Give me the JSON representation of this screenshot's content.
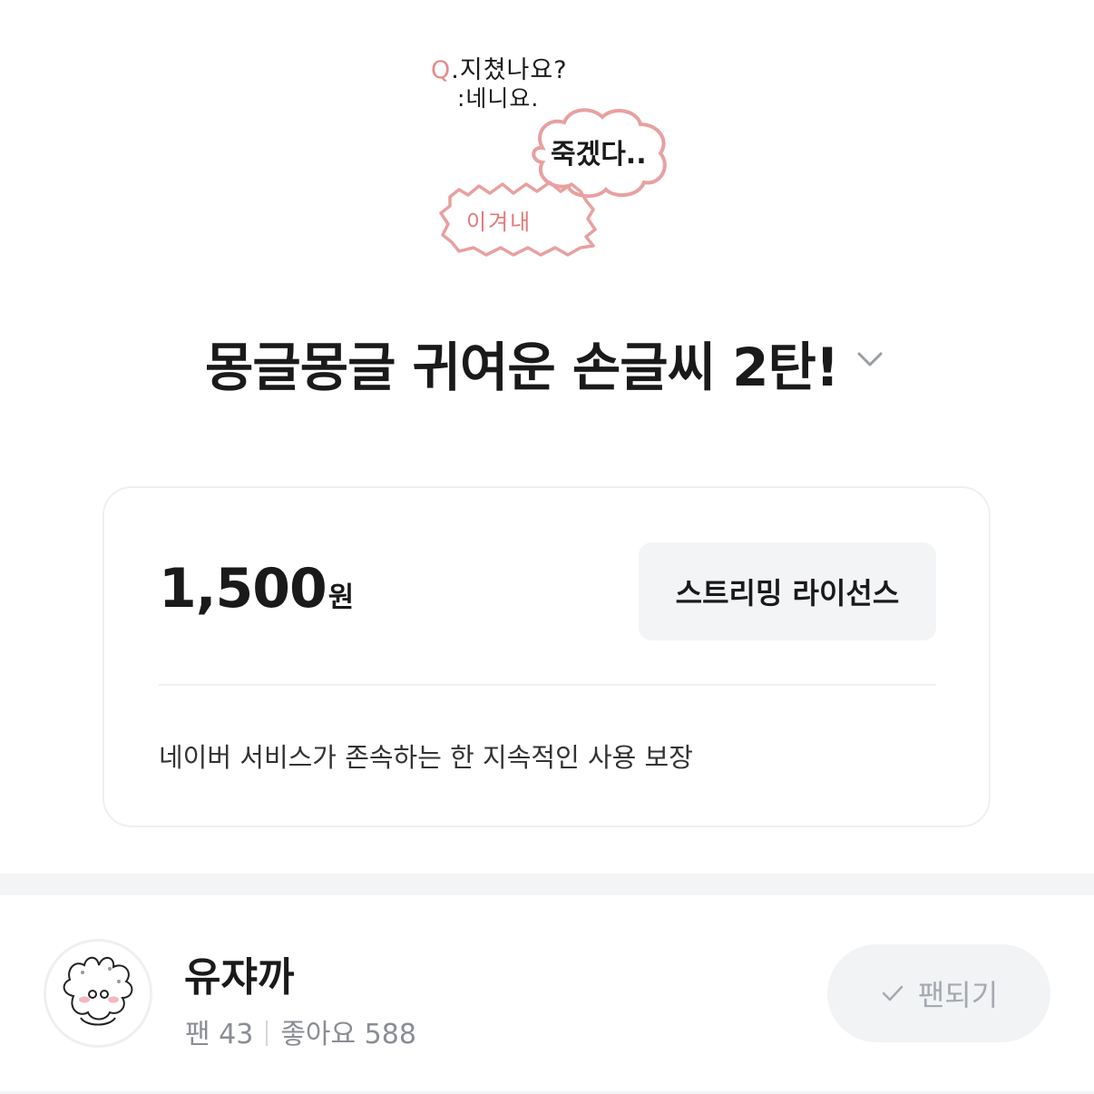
{
  "hero": {
    "q_mark": "Q",
    "q_text": ".지쳤나요?",
    "a_text": ":네니요.",
    "bubble_text": "죽겠다..",
    "burst_text": "이겨내"
  },
  "title": "몽글몽글 귀여운 손글씨 2탄!",
  "price": {
    "amount": "1,500",
    "unit": "원"
  },
  "license_label": "스트리밍 라이선스",
  "license_note": "네이버 서비스가 존속하는 한 지속적인 사용 보장",
  "creator": {
    "name": "유쟈까",
    "fans_label": "팬 43",
    "likes_label": "좋아요 588",
    "fan_button_label": "팬되기"
  },
  "colors": {
    "accent_pink": "#e58a8a",
    "button_bg": "#f3f4f6",
    "muted_text": "#8a8d93"
  },
  "icons": {
    "title_toggle": "chevron-down-icon",
    "fan_button": "check-icon"
  }
}
